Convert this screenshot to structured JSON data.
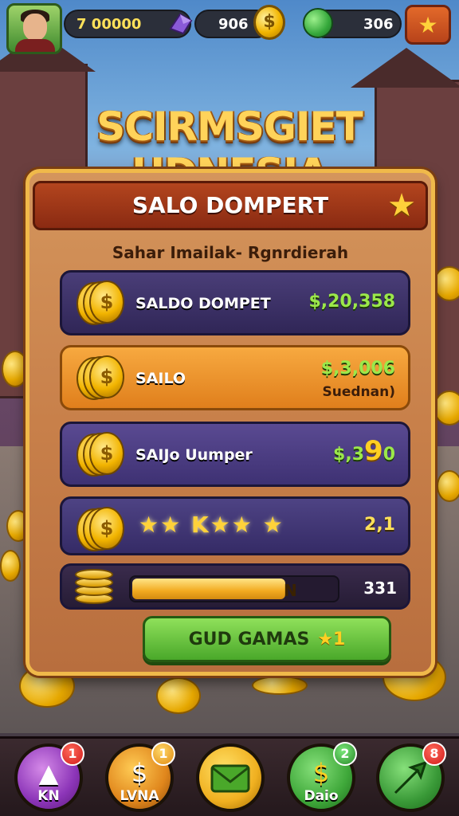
{
  "topbar": {
    "currency_1": "7 00000",
    "currency_2": "906",
    "currency_3": "306"
  },
  "game_title": "SCIRMSGIET HDNESIA",
  "panel": {
    "title": "SALO DOMPERT",
    "subtitle": "Sahar Imailak- Rgnrdierah",
    "rows": [
      {
        "label": "SALDO DOMPET",
        "value": "$,20,358"
      },
      {
        "label": "SAILO",
        "value": "$,3,006",
        "sub": "Suednan)"
      },
      {
        "label": "SAIJo Uumper",
        "value_pre": "$,3",
        "value_big": "9",
        "value_post": "0"
      },
      {
        "label": "",
        "value": "2,1",
        "stars": "★★ K★★ ★"
      },
      {
        "label": "",
        "value": "331",
        "progress_label": "N",
        "progress": 0.75
      }
    ],
    "button_label": "GUD GAMAS",
    "button_suffix": "★1"
  },
  "nav": [
    {
      "label": "KN",
      "badge": "1",
      "icon": "anvil-icon"
    },
    {
      "label": "LVNA",
      "badge": "1",
      "icon": "coin-sack-icon"
    },
    {
      "label": "",
      "badge": "",
      "icon": "envelope-icon"
    },
    {
      "label": "Daio",
      "badge": "2",
      "icon": "gold-coin-icon"
    },
    {
      "label": "",
      "badge": "8",
      "icon": "arrow-icon"
    }
  ],
  "colors": {
    "accent_gold": "#f0b94a",
    "value_green": "#9be84a",
    "header_red": "#b3451e"
  }
}
